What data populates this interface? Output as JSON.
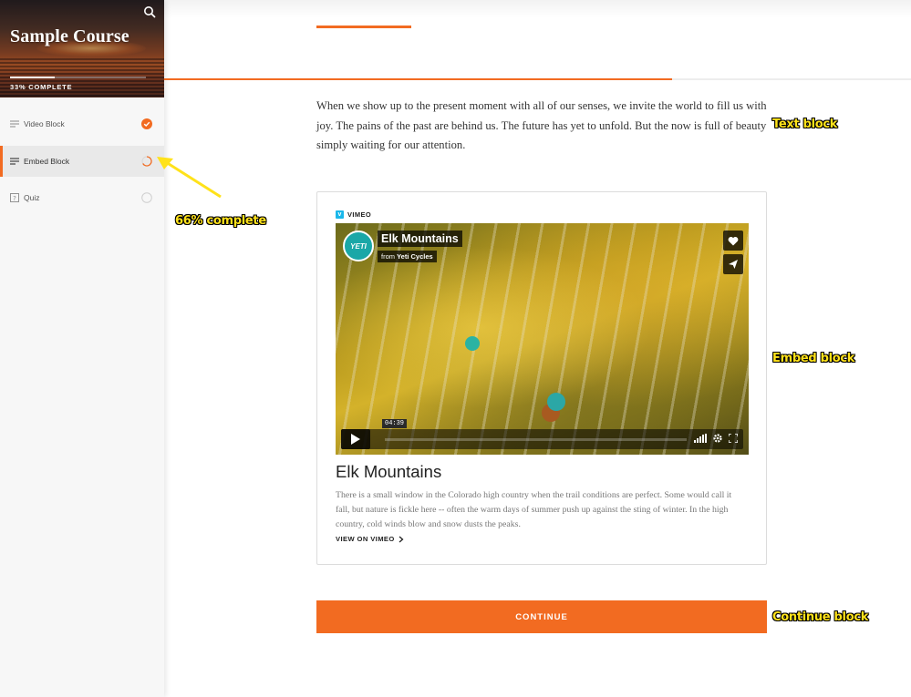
{
  "sidebar": {
    "course_title": "Sample Course",
    "progress_text": "33% COMPLETE",
    "progress_fraction": 0.33,
    "items": [
      {
        "label": "Video Block",
        "icon": "lines-icon",
        "status": "complete"
      },
      {
        "label": "Embed Block",
        "icon": "lines-icon",
        "status": "in-progress"
      },
      {
        "label": "Quiz",
        "icon": "quiz-icon",
        "status": "not-started"
      }
    ]
  },
  "main": {
    "lesson_progress_fraction": 0.68,
    "text_block": "When we show up to the present moment with all of our senses, we invite the world to fill us with joy. The pains of the past are behind us. The future has yet to unfold. But the now is full of beauty simply waiting for our attention.",
    "embed": {
      "provider": "VIMEO",
      "video": {
        "title": "Elk Mountains",
        "from_label": "from",
        "channel": "Yeti Cycles",
        "channel_logo_text": "YETI",
        "timestamp": "04:39"
      },
      "title": "Elk Mountains",
      "description": "There is a small window in the Colorado high country when the trail conditions are perfect. Some would call it fall, but nature is fickle here -- often the warm days of summer push up against the sting of winter. In the high country, cold winds blow and snow dusts the peaks.",
      "link_label": "VIEW ON VIMEO"
    },
    "continue_label": "CONTINUE"
  },
  "annotations": {
    "text_block": "Text block",
    "embed_block": "Embed block",
    "continue_block": "Continue block",
    "progress_note": "66% complete"
  },
  "colors": {
    "accent": "#f26b21",
    "vimeo": "#1ab7ea",
    "annotation": "#ffe21a"
  }
}
